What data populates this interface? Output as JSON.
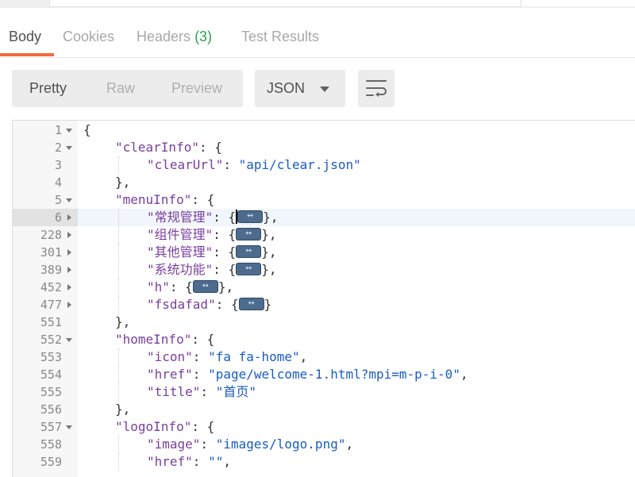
{
  "tabs": [
    {
      "label": "Body",
      "active": true
    },
    {
      "label": "Cookies",
      "active": false
    },
    {
      "label": "Headers",
      "count": "(3)",
      "active": false
    },
    {
      "label": "Test Results",
      "active": false
    }
  ],
  "toolbar": {
    "view_modes": [
      "Pretty",
      "Raw",
      "Preview"
    ],
    "selected_mode": "Pretty",
    "format": "JSON",
    "wrap_icon": "wrap-lines-icon"
  },
  "colors": {
    "accent": "#f26b3a",
    "count": "#2fa24c",
    "key": "#7a3e9d",
    "string": "#1a5cc4"
  },
  "editor": {
    "lines": [
      {
        "num": "1",
        "fold": "open",
        "indent": 0,
        "parts": [
          [
            "p",
            "{"
          ]
        ]
      },
      {
        "num": "2",
        "fold": "open",
        "indent": 1,
        "parts": [
          [
            "k",
            "\"clearInfo\""
          ],
          [
            "p",
            ": {"
          ]
        ]
      },
      {
        "num": "3",
        "fold": "",
        "indent": 2,
        "parts": [
          [
            "k",
            "\"clearUrl\""
          ],
          [
            "p",
            ": "
          ],
          [
            "s",
            "\"api/clear.json\""
          ]
        ]
      },
      {
        "num": "4",
        "fold": "",
        "indent": 1,
        "parts": [
          [
            "p",
            "},"
          ]
        ]
      },
      {
        "num": "5",
        "fold": "open",
        "indent": 1,
        "parts": [
          [
            "k",
            "\"menuInfo\""
          ],
          [
            "p",
            ": {"
          ]
        ]
      },
      {
        "num": "6",
        "fold": "closed",
        "indent": 2,
        "highlight": true,
        "cursor": true,
        "parts": [
          [
            "k",
            "\"常规管理\""
          ],
          [
            "p",
            ": {"
          ],
          [
            "pill",
            ""
          ],
          [
            "p",
            "},"
          ]
        ]
      },
      {
        "num": "228",
        "fold": "closed",
        "indent": 2,
        "parts": [
          [
            "k",
            "\"组件管理\""
          ],
          [
            "p",
            ": {"
          ],
          [
            "pill",
            ""
          ],
          [
            "p",
            "},"
          ]
        ]
      },
      {
        "num": "301",
        "fold": "closed",
        "indent": 2,
        "parts": [
          [
            "k",
            "\"其他管理\""
          ],
          [
            "p",
            ": {"
          ],
          [
            "pill",
            ""
          ],
          [
            "p",
            "},"
          ]
        ]
      },
      {
        "num": "389",
        "fold": "closed",
        "indent": 2,
        "parts": [
          [
            "k",
            "\"系统功能\""
          ],
          [
            "p",
            ": {"
          ],
          [
            "pill",
            ""
          ],
          [
            "p",
            "},"
          ]
        ]
      },
      {
        "num": "452",
        "fold": "closed",
        "indent": 2,
        "parts": [
          [
            "k",
            "\"h\""
          ],
          [
            "p",
            ": {"
          ],
          [
            "pill",
            ""
          ],
          [
            "p",
            "},"
          ]
        ]
      },
      {
        "num": "477",
        "fold": "closed",
        "indent": 2,
        "parts": [
          [
            "k",
            "\"fsdafad\""
          ],
          [
            "p",
            ": {"
          ],
          [
            "pill",
            ""
          ],
          [
            "p",
            "}"
          ]
        ]
      },
      {
        "num": "551",
        "fold": "",
        "indent": 1,
        "parts": [
          [
            "p",
            "},"
          ]
        ]
      },
      {
        "num": "552",
        "fold": "open",
        "indent": 1,
        "parts": [
          [
            "k",
            "\"homeInfo\""
          ],
          [
            "p",
            ": {"
          ]
        ]
      },
      {
        "num": "553",
        "fold": "",
        "indent": 2,
        "parts": [
          [
            "k",
            "\"icon\""
          ],
          [
            "p",
            ": "
          ],
          [
            "s",
            "\"fa fa-home\""
          ],
          [
            "p",
            ","
          ]
        ]
      },
      {
        "num": "554",
        "fold": "",
        "indent": 2,
        "parts": [
          [
            "k",
            "\"href\""
          ],
          [
            "p",
            ": "
          ],
          [
            "s",
            "\"page/welcome-1.html?mpi=m-p-i-0\""
          ],
          [
            "p",
            ","
          ]
        ]
      },
      {
        "num": "555",
        "fold": "",
        "indent": 2,
        "parts": [
          [
            "k",
            "\"title\""
          ],
          [
            "p",
            ": "
          ],
          [
            "s",
            "\"首页\""
          ]
        ]
      },
      {
        "num": "556",
        "fold": "",
        "indent": 1,
        "parts": [
          [
            "p",
            "},"
          ]
        ]
      },
      {
        "num": "557",
        "fold": "open",
        "indent": 1,
        "parts": [
          [
            "k",
            "\"logoInfo\""
          ],
          [
            "p",
            ": {"
          ]
        ]
      },
      {
        "num": "558",
        "fold": "",
        "indent": 2,
        "parts": [
          [
            "k",
            "\"image\""
          ],
          [
            "p",
            ": "
          ],
          [
            "s",
            "\"images/logo.png\""
          ],
          [
            "p",
            ","
          ]
        ]
      },
      {
        "num": "559",
        "fold": "",
        "indent": 2,
        "parts": [
          [
            "k",
            "\"href\""
          ],
          [
            "p",
            ": "
          ],
          [
            "s",
            "\"\""
          ],
          [
            "p",
            ","
          ]
        ]
      }
    ]
  }
}
